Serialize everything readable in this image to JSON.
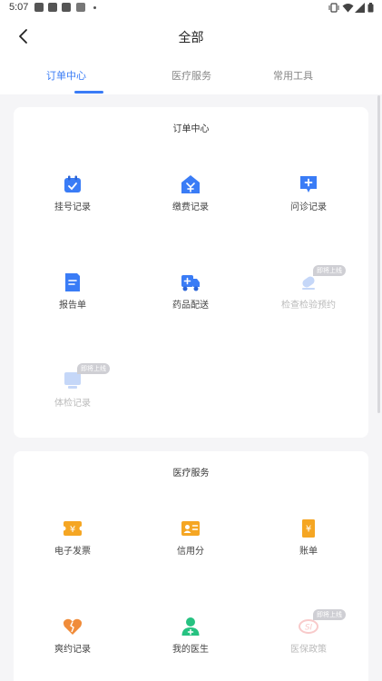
{
  "status_bar": {
    "time": "5:07"
  },
  "header": {
    "title": "全部"
  },
  "tabs": [
    {
      "label": "订单中心",
      "active": true
    },
    {
      "label": "医疗服务",
      "active": false
    },
    {
      "label": "常用工具",
      "active": false
    }
  ],
  "order_center": {
    "title": "订单中心",
    "items": [
      {
        "label": "挂号记录",
        "icon": "calendar-check-icon",
        "disabled": false
      },
      {
        "label": "缴费记录",
        "icon": "house-payment-icon",
        "disabled": false
      },
      {
        "label": "问诊记录",
        "icon": "chat-plus-icon",
        "disabled": false
      },
      {
        "label": "报告单",
        "icon": "document-icon",
        "disabled": false
      },
      {
        "label": "药品配送",
        "icon": "delivery-truck-icon",
        "disabled": false
      },
      {
        "label": "检查检验预约",
        "icon": "capsule-icon",
        "disabled": true,
        "badge": "即将上线"
      },
      {
        "label": "体检记录",
        "icon": "monitor-icon",
        "disabled": true,
        "badge": "即将上线"
      }
    ]
  },
  "medical_service": {
    "title": "医疗服务",
    "items": [
      {
        "label": "电子发票",
        "icon": "invoice-icon",
        "disabled": false
      },
      {
        "label": "信用分",
        "icon": "credit-card-icon",
        "disabled": false
      },
      {
        "label": "账单",
        "icon": "bill-icon",
        "disabled": false
      },
      {
        "label": "爽约记录",
        "icon": "broken-heart-icon",
        "disabled": false
      },
      {
        "label": "我的医生",
        "icon": "doctor-icon",
        "disabled": false
      },
      {
        "label": "医保政策",
        "icon": "si-logo-icon",
        "disabled": true,
        "badge": "即将上线"
      }
    ]
  },
  "colors": {
    "accent": "#3a7cf6",
    "orange": "#f5a623",
    "green": "#26c281",
    "disabled": "#bbbbbb"
  }
}
